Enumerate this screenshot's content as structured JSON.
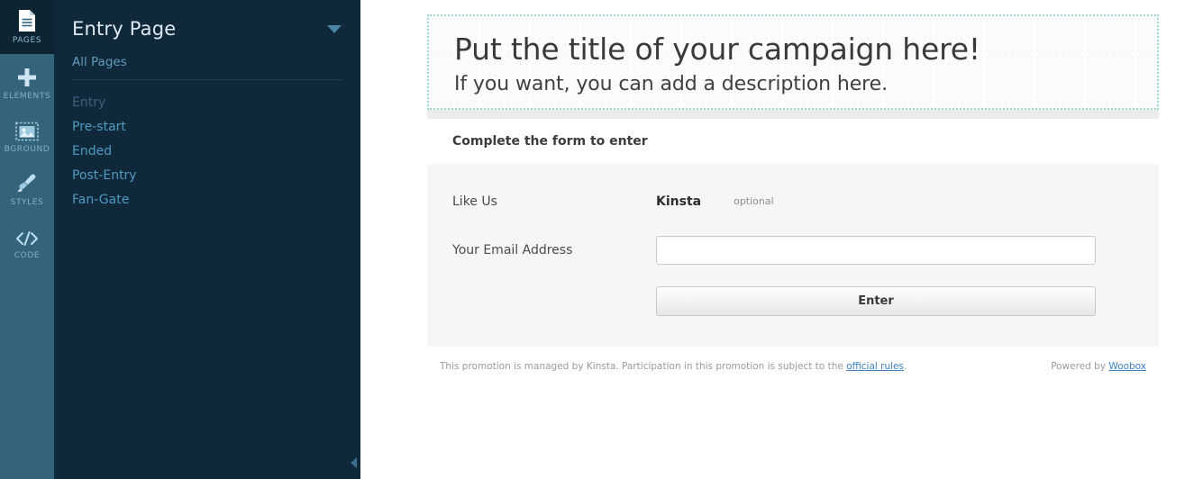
{
  "rail": {
    "items": [
      {
        "label": "PAGES",
        "icon": "document-icon",
        "active": true
      },
      {
        "label": "ELEMENTS",
        "icon": "plus-icon",
        "active": false
      },
      {
        "label": "BGROUND",
        "icon": "image-icon",
        "active": false
      },
      {
        "label": "STYLES",
        "icon": "brush-icon",
        "active": false
      },
      {
        "label": "CODE",
        "icon": "code-icon",
        "active": false
      }
    ],
    "active_bg": "#0e2433",
    "bg": "#33647c"
  },
  "panel": {
    "title": "Entry Page",
    "dropdown_icon": "chevron-down-icon",
    "all_pages_label": "All Pages",
    "collapse_icon": "collapse-left-icon",
    "pages": [
      {
        "label": "Entry",
        "current": true
      },
      {
        "label": "Pre-start",
        "current": false
      },
      {
        "label": "Ended",
        "current": false
      },
      {
        "label": "Post-Entry",
        "current": false
      },
      {
        "label": "Fan-Gate",
        "current": false
      }
    ],
    "bg": "#10293a",
    "link_color": "#4f9ac0"
  },
  "campaign": {
    "hero": {
      "title": "Put the title of your campaign here!",
      "description": "If you want, you can add a description here.",
      "selection_border_color": "#9fd9cb"
    },
    "form_heading": "Complete the form to enter",
    "fields": [
      {
        "label": "Like Us",
        "type": "like",
        "brand": "Kinsta",
        "optional_tag": "optional"
      },
      {
        "label": "Your Email Address",
        "type": "text",
        "value": "",
        "placeholder": ""
      }
    ],
    "submit_label": "Enter",
    "footer": {
      "text_before": "This promotion is managed by Kinsta. Participation in this promotion is subject to the ",
      "link_label": "official rules",
      "text_after": ".",
      "powered_by_prefix": "Powered by ",
      "powered_by_link": "Woobox",
      "link_color": "#3b7fc4"
    }
  }
}
